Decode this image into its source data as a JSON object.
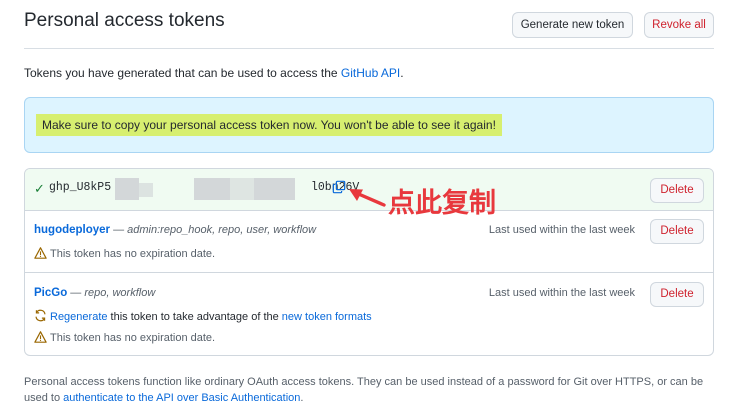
{
  "header": {
    "title": "Personal access tokens",
    "generate_label": "Generate new token",
    "revoke_all_label": "Revoke all"
  },
  "intro": {
    "text": "Tokens you have generated that can be used to access the ",
    "link": "GitHub API",
    "suffix": "."
  },
  "flash": {
    "message": "Make sure to copy your personal access token now. You won't be able to see it again!"
  },
  "new_token": {
    "prefix": "ghp_U8kP5",
    "suffix": "l0bn26V",
    "delete_label": "Delete"
  },
  "tokens": [
    {
      "name": "hugodeployer",
      "scopes_dash": " — ",
      "scopes": "admin:repo_hook, repo, user, workflow",
      "last_used": "Last used within the last week",
      "warning": "This token has no expiration date.",
      "delete_label": "Delete"
    },
    {
      "name": "PicGo",
      "scopes_dash": " — ",
      "scopes": "repo, workflow",
      "last_used": "Last used within the last week",
      "regen_link": "Regenerate",
      "regen_text": " this token to take advantage of the ",
      "regen_link2": "new token formats",
      "warning": "This token has no expiration date.",
      "delete_label": "Delete"
    }
  ],
  "annotation": {
    "text": "点此复制",
    "color": "#e8383d"
  },
  "footer": {
    "text": "Personal access tokens function like ordinary OAuth access tokens. They can be used instead of a password for Git over HTTPS, or can be used to ",
    "link": "authenticate to the API over Basic Authentication",
    "suffix": "."
  },
  "colors": {
    "link": "#0969da",
    "danger": "#cf222e",
    "success": "#1a7f37",
    "flash_bg": "#ddf4ff",
    "highlight": "#d7ef70",
    "warning_icon": "#9a6700"
  }
}
